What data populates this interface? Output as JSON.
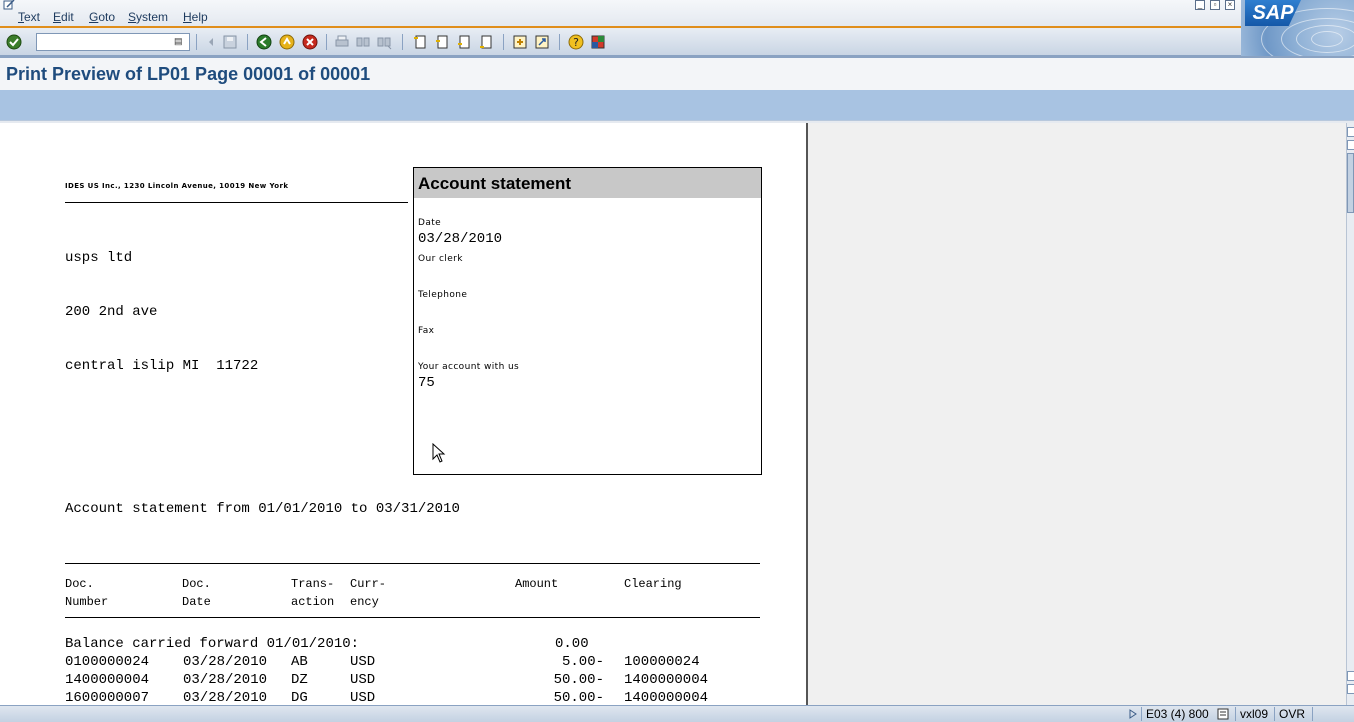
{
  "menu": {
    "items": [
      "Text",
      "Edit",
      "Goto",
      "System",
      "Help"
    ],
    "mnemonics": [
      "T",
      "E",
      "G",
      "S",
      "H"
    ]
  },
  "logo": {
    "text": "SAP"
  },
  "toolbar": {
    "command_value": ""
  },
  "title": "Print Preview of LP01 Page 00001 of 00001",
  "document": {
    "sender_line": "IDES US Inc., 1230 Lincoln Avenue, 10019 New York",
    "address": [
      "usps ltd",
      "200 2nd ave",
      "central islip MI  11722"
    ],
    "box": {
      "title": "Account statement",
      "date_label": "Date",
      "date_value": "03/28/2010",
      "clerk_label": "Our clerk",
      "telephone_label": "Telephone",
      "fax_label": "Fax",
      "account_label": "Your account with us",
      "account_value": "75"
    },
    "period_line": "Account statement from 01/01/2010 to 03/31/2010",
    "table": {
      "headers": [
        {
          "line1": "Doc.",
          "line2": "Number"
        },
        {
          "line1": "Doc.",
          "line2": "Date"
        },
        {
          "line1": "Trans-",
          "line2": "action"
        },
        {
          "line1": "Curr-",
          "line2": "ency"
        },
        {
          "line1": "Amount",
          "line2": ""
        },
        {
          "line1": "Clearing",
          "line2": ""
        }
      ],
      "balance_label": "Balance carried forward 01/01/2010:",
      "balance_amount": "0.00",
      "rows": [
        {
          "number": "0100000024",
          "date": "03/28/2010",
          "trans": "AB",
          "curr": "USD",
          "amount": "5.00-",
          "clearing": "100000024"
        },
        {
          "number": "1400000004",
          "date": "03/28/2010",
          "trans": "DZ",
          "curr": "USD",
          "amount": "50.00-",
          "clearing": "1400000004"
        },
        {
          "number": "1600000007",
          "date": "03/28/2010",
          "trans": "DG",
          "curr": "USD",
          "amount": "50.00-",
          "clearing": "1400000004"
        }
      ]
    }
  },
  "status": {
    "system": "E03 (4) 800",
    "server": "vxl09",
    "mode": "OVR"
  },
  "colors": {
    "accent_orange": "#e08e1b",
    "title_blue": "#1f4c7e",
    "app_toolbar": "#a8c3e2"
  }
}
